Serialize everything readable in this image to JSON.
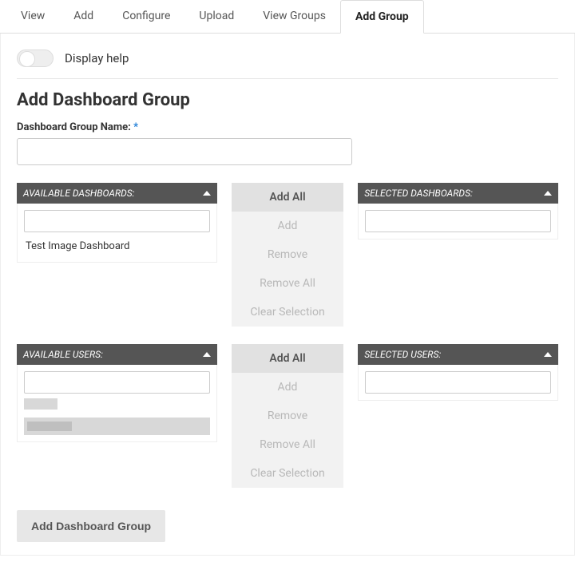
{
  "tabs": {
    "view": "View",
    "add": "Add",
    "configure": "Configure",
    "upload": "Upload",
    "view_groups": "View Groups",
    "add_group": "Add Group"
  },
  "help_toggle_label": "Display help",
  "page_title": "Add Dashboard Group",
  "name_field": {
    "label": "Dashboard Group Name:",
    "required_marker": "*",
    "value": ""
  },
  "dashboards": {
    "available_header": "AVAILABLE DASHBOARDS:",
    "selected_header": "SELECTED DASHBOARDS:",
    "available_items": [
      "Test Image Dashboard"
    ],
    "available_filter": "",
    "selected_filter": ""
  },
  "users": {
    "available_header": "AVAILABLE USERS:",
    "selected_header": "SELECTED USERS:",
    "available_filter": "",
    "selected_filter": ""
  },
  "actions": {
    "add_all": "Add All",
    "add": "Add",
    "remove": "Remove",
    "remove_all": "Remove All",
    "clear_selection": "Clear Selection"
  },
  "submit_label": "Add Dashboard Group"
}
